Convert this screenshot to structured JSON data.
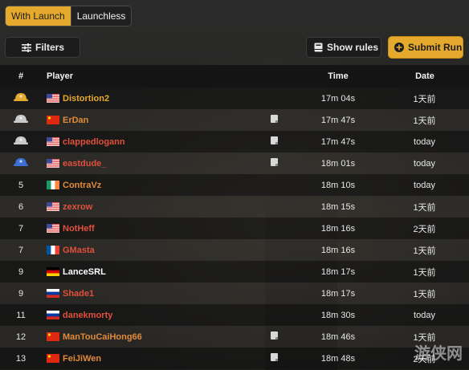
{
  "toggle": {
    "with_launch": "With Launch",
    "launchless": "Launchless"
  },
  "toolbar": {
    "filters": "Filters",
    "show_rules": "Show rules",
    "submit_run": "Submit Run"
  },
  "columns": {
    "rank": "#",
    "player": "Player",
    "time": "Time",
    "date": "Date"
  },
  "colors": {
    "accent": "#e5a92e",
    "gold": "#e5a92e",
    "red": "#e0503b",
    "white": "#ffffff"
  },
  "rows": [
    {
      "rank": "",
      "rank_icon": "gold-medal-icon",
      "flag": "us",
      "player": "Distortion2",
      "color": "#e5a92e",
      "note": false,
      "time": "17m 04s",
      "date": "1天前"
    },
    {
      "rank": "",
      "rank_icon": "silver-medal-icon",
      "flag": "cn",
      "player": "ErDan",
      "color": "#e08a3a",
      "note": true,
      "time": "17m 47s",
      "date": "1天前"
    },
    {
      "rank": "",
      "rank_icon": "silver-medal-icon",
      "flag": "us",
      "player": "clappedlogann",
      "color": "#e0503b",
      "note": true,
      "time": "17m 47s",
      "date": "today"
    },
    {
      "rank": "",
      "rank_icon": "blue-medal-icon",
      "flag": "us",
      "player": "eastdude_",
      "color": "#e0503b",
      "note": true,
      "time": "18m 01s",
      "date": "today"
    },
    {
      "rank": "5",
      "rank_icon": "",
      "flag": "ie",
      "player": "ContraVz",
      "color": "#e08a3a",
      "note": false,
      "time": "18m 10s",
      "date": "today"
    },
    {
      "rank": "6",
      "rank_icon": "",
      "flag": "us",
      "player": "zexrow",
      "color": "#e0503b",
      "note": false,
      "time": "18m 15s",
      "date": "1天前"
    },
    {
      "rank": "7",
      "rank_icon": "",
      "flag": "us",
      "player": "NotHeff",
      "color": "#e0503b",
      "note": false,
      "time": "18m 16s",
      "date": "2天前"
    },
    {
      "rank": "7",
      "rank_icon": "",
      "flag": "fr",
      "player": "GMasta",
      "color": "#e0503b",
      "note": false,
      "time": "18m 16s",
      "date": "1天前"
    },
    {
      "rank": "9",
      "rank_icon": "",
      "flag": "de",
      "player": "LanceSRL",
      "color": "#ffffff",
      "note": false,
      "time": "18m 17s",
      "date": "1天前"
    },
    {
      "rank": "9",
      "rank_icon": "",
      "flag": "ru",
      "player": "Shade1",
      "color": "#e0503b",
      "note": false,
      "time": "18m 17s",
      "date": "1天前"
    },
    {
      "rank": "11",
      "rank_icon": "",
      "flag": "ru",
      "player": "danekmorty",
      "color": "#e0503b",
      "note": false,
      "time": "18m 30s",
      "date": "today"
    },
    {
      "rank": "12",
      "rank_icon": "",
      "flag": "cn",
      "player": "ManTouCaiHong66",
      "color": "#e08a3a",
      "note": true,
      "time": "18m 46s",
      "date": "1天前"
    },
    {
      "rank": "13",
      "rank_icon": "",
      "flag": "cn",
      "player": "FeiJiWen",
      "color": "#e08a3a",
      "note": true,
      "time": "18m 48s",
      "date": "2天前"
    }
  ],
  "watermark": "游侠网"
}
